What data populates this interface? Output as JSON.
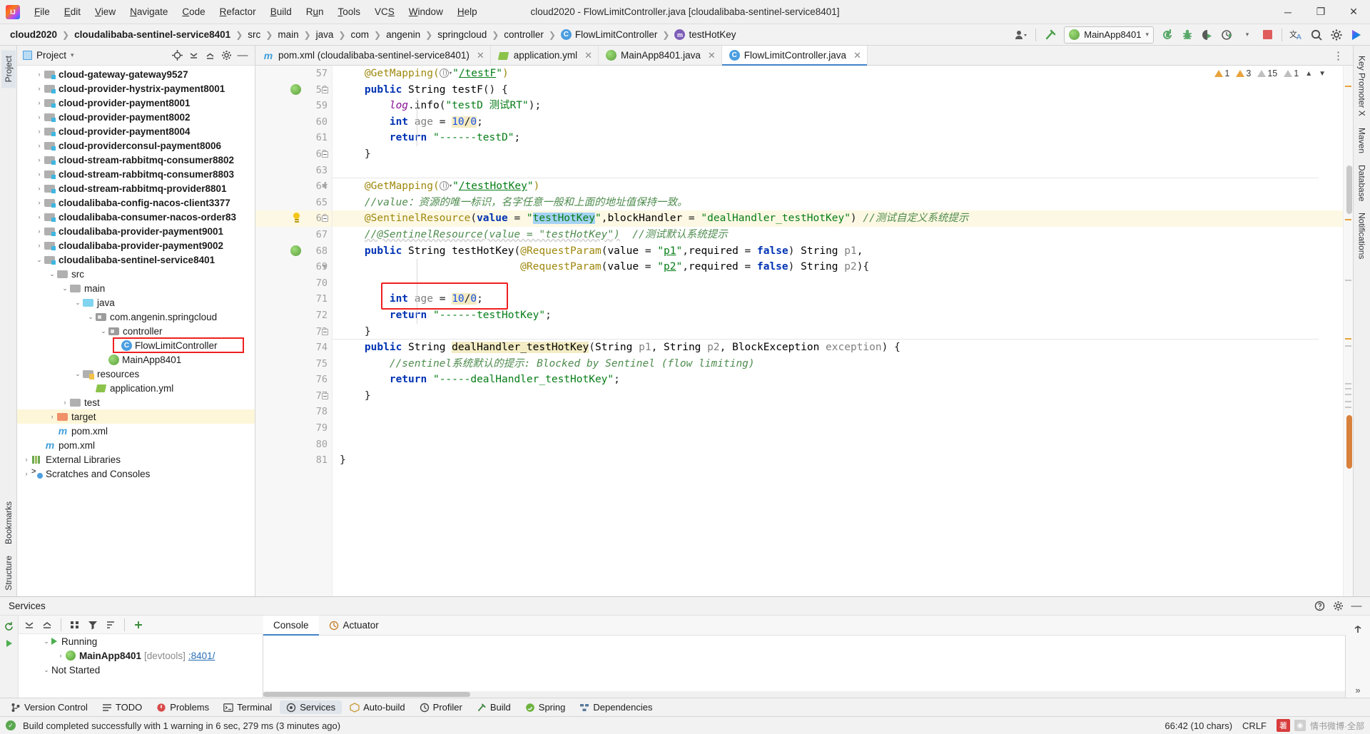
{
  "window": {
    "title": "cloud2020 - FlowLimitController.java [cloudalibaba-sentinel-service8401]",
    "minimize": "─",
    "maximize": "❐",
    "close": "✕"
  },
  "menu": {
    "items": [
      "File",
      "Edit",
      "View",
      "Navigate",
      "Code",
      "Refactor",
      "Build",
      "Run",
      "Tools",
      "VCS",
      "Window",
      "Help"
    ]
  },
  "breadcrumb": {
    "items": [
      {
        "label": "cloud2020",
        "bold": true
      },
      {
        "label": "cloudalibaba-sentinel-service8401",
        "bold": true
      },
      {
        "label": "src",
        "bold": false
      },
      {
        "label": "main",
        "bold": false
      },
      {
        "label": "java",
        "bold": false
      },
      {
        "label": "com",
        "bold": false
      },
      {
        "label": "angenin",
        "bold": false
      },
      {
        "label": "springcloud",
        "bold": false
      },
      {
        "label": "controller",
        "bold": false
      },
      {
        "label": "FlowLimitController",
        "bold": false,
        "icon": "class-icon"
      },
      {
        "label": "testHotKey",
        "bold": false,
        "icon": "method-icon"
      }
    ],
    "separator": "❯"
  },
  "toolbar": {
    "run_config": "MainApp8401",
    "icons": [
      "people-icon",
      "hammer-icon",
      "rerun-icon",
      "debug-icon",
      "coverage-icon",
      "profiler-icon",
      "stop-icon",
      "translate-icon",
      "search-everywhere-icon",
      "settings-icon",
      "ide-assistant-icon"
    ],
    "stop_color": "#e05c5c",
    "run_green": "#59a869"
  },
  "project_panel": {
    "title": "Project",
    "header_icons": [
      "locate-icon",
      "collapse-all-icon",
      "expand-all-icon",
      "settings-icon",
      "hide-icon"
    ],
    "tree": [
      {
        "indent": 1,
        "twist": "›",
        "icon": "module-icon",
        "label": "cloud-gateway-gateway9527",
        "bold": true
      },
      {
        "indent": 1,
        "twist": "›",
        "icon": "module-icon",
        "label": "cloud-provider-hystrix-payment8001",
        "bold": true
      },
      {
        "indent": 1,
        "twist": "›",
        "icon": "module-icon",
        "label": "cloud-provider-payment8001",
        "bold": true
      },
      {
        "indent": 1,
        "twist": "›",
        "icon": "module-icon",
        "label": "cloud-provider-payment8002",
        "bold": true
      },
      {
        "indent": 1,
        "twist": "›",
        "icon": "module-icon",
        "label": "cloud-provider-payment8004",
        "bold": true
      },
      {
        "indent": 1,
        "twist": "›",
        "icon": "module-icon",
        "label": "cloud-providerconsul-payment8006",
        "bold": true
      },
      {
        "indent": 1,
        "twist": "›",
        "icon": "module-icon",
        "label": "cloud-stream-rabbitmq-consumer8802",
        "bold": true
      },
      {
        "indent": 1,
        "twist": "›",
        "icon": "module-icon",
        "label": "cloud-stream-rabbitmq-consumer8803",
        "bold": true
      },
      {
        "indent": 1,
        "twist": "›",
        "icon": "module-icon",
        "label": "cloud-stream-rabbitmq-provider8801",
        "bold": true
      },
      {
        "indent": 1,
        "twist": "›",
        "icon": "module-icon",
        "label": "cloudalibaba-config-nacos-client3377",
        "bold": true
      },
      {
        "indent": 1,
        "twist": "›",
        "icon": "module-icon",
        "label": "cloudalibaba-consumer-nacos-order83",
        "bold": true
      },
      {
        "indent": 1,
        "twist": "›",
        "icon": "module-icon",
        "label": "cloudalibaba-provider-payment9001",
        "bold": true
      },
      {
        "indent": 1,
        "twist": "›",
        "icon": "module-icon",
        "label": "cloudalibaba-provider-payment9002",
        "bold": true
      },
      {
        "indent": 1,
        "twist": "⌄",
        "icon": "module-icon",
        "label": "cloudalibaba-sentinel-service8401",
        "bold": true
      },
      {
        "indent": 2,
        "twist": "⌄",
        "icon": "folder-icon",
        "label": "src",
        "bold": false
      },
      {
        "indent": 3,
        "twist": "⌄",
        "icon": "folder-icon",
        "label": "main",
        "bold": false
      },
      {
        "indent": 4,
        "twist": "⌄",
        "icon": "source-folder-icon",
        "label": "java",
        "bold": false
      },
      {
        "indent": 5,
        "twist": "⌄",
        "icon": "package-icon",
        "label": "com.angenin.springcloud",
        "bold": false
      },
      {
        "indent": 6,
        "twist": "⌄",
        "icon": "package-icon",
        "label": "controller",
        "bold": false
      },
      {
        "indent": 7,
        "twist": "",
        "icon": "class-icon",
        "label": "FlowLimitController",
        "bold": false,
        "highlight_box": true
      },
      {
        "indent": 6,
        "twist": "",
        "icon": "spring-boot-icon",
        "label": "MainApp8401",
        "bold": false
      },
      {
        "indent": 4,
        "twist": "⌄",
        "icon": "resources-folder-icon",
        "label": "resources",
        "bold": false
      },
      {
        "indent": 5,
        "twist": "",
        "icon": "yaml-icon",
        "label": "application.yml",
        "bold": false
      },
      {
        "indent": 3,
        "twist": "›",
        "icon": "folder-icon",
        "label": "test",
        "bold": false
      },
      {
        "indent": 2,
        "twist": "›",
        "icon": "target-folder-icon",
        "label": "target",
        "bold": false,
        "row_highlight": true
      },
      {
        "indent": 2,
        "twist": "",
        "icon": "maven-icon",
        "label": "pom.xml",
        "bold": false
      },
      {
        "indent": 1,
        "twist": "",
        "icon": "maven-icon",
        "label": "pom.xml",
        "bold": false
      },
      {
        "indent": 0,
        "twist": "›",
        "icon": "libraries-icon",
        "label": "External Libraries",
        "bold": false
      },
      {
        "indent": 0,
        "twist": "›",
        "icon": "scratches-icon",
        "label": "Scratches and Consoles",
        "bold": false
      }
    ]
  },
  "left_strip": [
    {
      "label": "Project",
      "active": true
    },
    {
      "label": "Bookmarks",
      "active": false
    },
    {
      "label": "Structure",
      "active": false
    }
  ],
  "right_strip": [
    {
      "label": "Key Promoter X"
    },
    {
      "label": "Maven"
    },
    {
      "label": "Database"
    },
    {
      "label": "Notifications"
    }
  ],
  "editor_tabs": [
    {
      "label": "pom.xml (cloudalibaba-sentinel-service8401)",
      "icon": "maven-icon",
      "active": false,
      "close": "✕"
    },
    {
      "label": "application.yml",
      "icon": "spring-yaml-icon",
      "active": false,
      "close": "✕"
    },
    {
      "label": "MainApp8401.java",
      "icon": "spring-boot-icon",
      "active": false,
      "close": "✕"
    },
    {
      "label": "FlowLimitController.java",
      "icon": "class-icon",
      "active": true,
      "close": "✕"
    }
  ],
  "inspection": {
    "errors": "1",
    "warnings": "3",
    "weak_warnings": "15",
    "typos": "1",
    "chevron_up": "⌃",
    "chevron_down": "⌄"
  },
  "code": {
    "first_line": 57,
    "lines": [
      {
        "n": 57,
        "text": "    @GetMapping(Ⓘ⌄\"/testF\")"
      },
      {
        "n": 58,
        "text": "    public String testF() {",
        "gutter": "spring-run-icon"
      },
      {
        "n": 59,
        "text": "        log.info(\"testD 测试RT\");"
      },
      {
        "n": 60,
        "text": "        int age = 10/0;"
      },
      {
        "n": 61,
        "text": "        return \"------testD\";"
      },
      {
        "n": 62,
        "text": "    }"
      },
      {
        "n": 63,
        "text": ""
      },
      {
        "n": 64,
        "text": "    @GetMapping(Ⓘ⌄\"/testHotKey\")"
      },
      {
        "n": 65,
        "text": "    //value：资源的唯一标识，名字任意一般和上面的地址值保持一致。"
      },
      {
        "n": 66,
        "text": "    @SentinelResource(value = \"testHotKey\",blockHandler = \"dealHandler_testHotKey\") //测试自定义系统提示",
        "gutter": "bulb-icon",
        "highlight": true
      },
      {
        "n": 67,
        "text": "    //@SentinelResource(value = \"testHotKey\")  //测试默认系统提示"
      },
      {
        "n": 68,
        "text": "    public String testHotKey(@RequestParam(value = \"p1\",required = false) String p1,",
        "gutter": "spring-run-icon"
      },
      {
        "n": 69,
        "text": "                             @RequestParam(value = \"p2\",required = false) String p2){"
      },
      {
        "n": 70,
        "text": ""
      },
      {
        "n": 71,
        "text": "        int age = 10/0;"
      },
      {
        "n": 72,
        "text": "        return \"------testHotKey\";"
      },
      {
        "n": 73,
        "text": "    }"
      },
      {
        "n": 74,
        "text": "    public String dealHandler_testHotKey(String p1, String p2, BlockException exception) {"
      },
      {
        "n": 75,
        "text": "        //sentinel系统默认的提示: Blocked by Sentinel (flow limiting)"
      },
      {
        "n": 76,
        "text": "        return \"-----dealHandler_testHotKey\";"
      },
      {
        "n": 77,
        "text": "    }"
      },
      {
        "n": 78,
        "text": ""
      },
      {
        "n": 79,
        "text": ""
      },
      {
        "n": 80,
        "text": ""
      },
      {
        "n": 81,
        "text": "}"
      }
    ],
    "annotation_box_label": "red-highlight-box"
  },
  "services": {
    "panel_title": "Services",
    "toolbar_icons": [
      "refresh-icon",
      "collapse-icon",
      "expand-icon",
      "group-icon",
      "filter-icon",
      "sort-icon",
      "add-icon"
    ],
    "tree": [
      {
        "indent": 1,
        "twist": "⌄",
        "icon": "run-icon",
        "label": "Running",
        "bold": false
      },
      {
        "indent": 2,
        "twist": "›",
        "icon": "spring-boot-icon",
        "label": "MainApp8401",
        "bold": true,
        "suffix": " [devtools]",
        "link": ":8401/"
      },
      {
        "indent": 1,
        "twist": "⌄",
        "icon": "",
        "label": "Not Started",
        "bold": false
      }
    ],
    "console_tabs": [
      {
        "label": "Console",
        "active": true
      },
      {
        "label": "Actuator",
        "active": false,
        "icon": "actuator-icon"
      }
    ],
    "header_icons": [
      "help-icon",
      "settings-icon",
      "hide-icon"
    ]
  },
  "tool_window_bar": [
    {
      "label": "Version Control",
      "icon": "branch-icon",
      "active": false
    },
    {
      "label": "TODO",
      "icon": "todo-icon",
      "active": false
    },
    {
      "label": "Problems",
      "icon": "problems-icon",
      "active": false
    },
    {
      "label": "Terminal",
      "icon": "terminal-icon",
      "active": false
    },
    {
      "label": "Services",
      "icon": "services-icon",
      "active": true
    },
    {
      "label": "Auto-build",
      "icon": "autobuild-icon",
      "active": false
    },
    {
      "label": "Profiler",
      "icon": "profiler-icon",
      "active": false
    },
    {
      "label": "Build",
      "icon": "build-icon",
      "active": false
    },
    {
      "label": "Spring",
      "icon": "spring-icon",
      "active": false
    },
    {
      "label": "Dependencies",
      "icon": "dependencies-icon",
      "active": false
    }
  ],
  "status_bar": {
    "message": "Build completed successfully with 1 warning in 6 sec, 279 ms (3 minutes ago)",
    "caret": "66:42 (10 chars)",
    "line_separator": "CRLF",
    "watermark_badge": "薯",
    "watermark_text": "情书微博·全部"
  },
  "colors": {
    "accent": "#4083c9",
    "red_box": "#f01f1f",
    "warning": "#e8a33d",
    "error": "#e05c5c",
    "spring_green": "#6db33f",
    "highlight_yellow": "#f7e7b0",
    "selection_blue": "#a6d2f5"
  }
}
